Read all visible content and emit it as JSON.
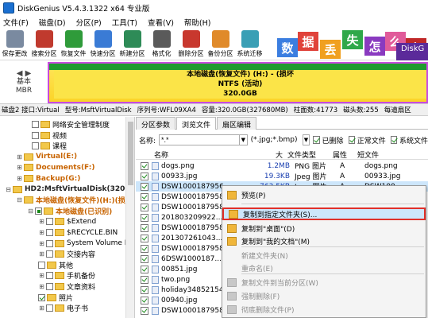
{
  "title": "DiskGenius V5.4.3.1322 x64 专业版",
  "menu": [
    "文件(F)",
    "磁盘(D)",
    "分区(P)",
    "工具(T)",
    "查看(V)",
    "帮助(H)"
  ],
  "toolbar": [
    {
      "label": "保存更改",
      "icon": "save-icon",
      "color": "#7a8aa0"
    },
    {
      "label": "搜索分区",
      "icon": "search-icon",
      "color": "#c03a2e"
    },
    {
      "label": "恢复文件",
      "icon": "recover-icon",
      "color": "#2f9b3a"
    },
    {
      "label": "快速分区",
      "icon": "quick-partition-icon",
      "color": "#3a7bd5"
    },
    {
      "label": "新建分区",
      "icon": "new-partition-icon",
      "color": "#2e8b57"
    },
    {
      "label": "格式化",
      "icon": "format-icon",
      "color": "#5a5a5a"
    },
    {
      "label": "删除分区",
      "icon": "delete-icon",
      "color": "#c8382e"
    },
    {
      "label": "备份分区",
      "icon": "backup-icon",
      "color": "#e08a2a"
    },
    {
      "label": "系统迁移",
      "icon": "migrate-icon",
      "color": "#3a9fb5"
    }
  ],
  "ad": {
    "chars": [
      "数",
      "据",
      "丢",
      "失",
      "怎",
      "么",
      "办"
    ],
    "brand": "DiskG"
  },
  "diskmap": {
    "nav_label": "基本\nMBR",
    "partition_name": "本地磁盘(恢复文件) (H:) - (损坏",
    "fs": "NTFS (活动)",
    "size": "320.0GB"
  },
  "status": [
    "磁盘2 接口:Virtual",
    "型号:MsftVirtualDisk",
    "序列号:WFL09XA4",
    "容量:320.0GB(327680MB)",
    "柱面数:41773",
    "磁头数:255",
    "每道扇区"
  ],
  "tree": [
    {
      "label": "网络安全管理制度",
      "indent": 40,
      "exp": "",
      "check": "",
      "style": ""
    },
    {
      "label": "视频",
      "indent": 40,
      "exp": "",
      "check": "",
      "style": ""
    },
    {
      "label": "课程",
      "indent": 40,
      "exp": "",
      "check": "",
      "style": ""
    },
    {
      "label": "Virtual(E:)",
      "indent": 20,
      "exp": "+",
      "check": "",
      "style": "orange"
    },
    {
      "label": "Documents(F:)",
      "indent": 20,
      "exp": "+",
      "check": "",
      "style": "orange"
    },
    {
      "label": "Backup(G:)",
      "indent": 20,
      "exp": "+",
      "check": "",
      "style": "orange"
    },
    {
      "label": "HD2:MsftVirtualDisk(320GB)",
      "indent": 6,
      "exp": "-",
      "check": "",
      "style": "dark-bold"
    },
    {
      "label": "本地磁盘(恢复文件)(H:)(损坏",
      "indent": 20,
      "exp": "-",
      "check": "",
      "style": "orange"
    },
    {
      "label": "本地磁盘(已识别)",
      "indent": 34,
      "exp": "-",
      "check": "part",
      "style": "orange"
    },
    {
      "label": "$Extend",
      "indent": 48,
      "exp": "+",
      "check": "",
      "style": ""
    },
    {
      "label": "$RECYCLE.BIN",
      "indent": 48,
      "exp": "+",
      "check": "",
      "style": ""
    },
    {
      "label": "System Volume In",
      "indent": 48,
      "exp": "+",
      "check": "",
      "style": ""
    },
    {
      "label": "交接内容",
      "indent": 48,
      "exp": "+",
      "check": "",
      "style": ""
    },
    {
      "label": "其他",
      "indent": 48,
      "exp": "",
      "check": "",
      "style": ""
    },
    {
      "label": "手机备份",
      "indent": 48,
      "exp": "+",
      "check": "",
      "style": ""
    },
    {
      "label": "文章资料",
      "indent": 48,
      "exp": "+",
      "check": "",
      "style": ""
    },
    {
      "label": "照片",
      "indent": 48,
      "exp": "",
      "check": "on",
      "style": ""
    },
    {
      "label": "电子书",
      "indent": 48,
      "exp": "+",
      "check": "",
      "style": ""
    }
  ],
  "tabs": [
    "分区参数",
    "浏览文件",
    "扇区编辑"
  ],
  "filter": {
    "name_value": "*.*",
    "ext_value": "(*.jpg;*.bmp)",
    "deleted": "已删除",
    "normal": "正常文件",
    "system": "系统文件"
  },
  "columns": {
    "name": "名称",
    "size": "大",
    "type": "文件类型",
    "attr": "属性",
    "short": "短文件"
  },
  "files": [
    {
      "name": "dogs.png",
      "size": "1.2MB",
      "type": "PNG 图片",
      "attr": "A",
      "short": "dogs.png"
    },
    {
      "name": "00933.jpg",
      "size": "19.3KB",
      "type": "Jpeg 图片",
      "attr": "A",
      "short": "00933.jpg"
    },
    {
      "name": "DSW1000187956...",
      "size": "763.5KB",
      "type": "Jpeg 图片",
      "attr": "A",
      "short": "DSW100~"
    },
    {
      "name": "DSW1000187958...",
      "size": "",
      "type": "",
      "attr": "",
      "short": ""
    },
    {
      "name": "DSW1000187958...",
      "size": "",
      "type": "",
      "attr": "",
      "short": ""
    },
    {
      "name": "201803209922...",
      "size": "",
      "type": "",
      "attr": "",
      "short": ""
    },
    {
      "name": "DSW1000187958...",
      "size": "",
      "type": "",
      "attr": "",
      "short": ""
    },
    {
      "name": "201307261043...",
      "size": "",
      "type": "",
      "attr": "",
      "short": ""
    },
    {
      "name": "DSW1000187958...",
      "size": "",
      "type": "",
      "attr": "",
      "short": ""
    },
    {
      "name": "6DSW1000187...",
      "size": "",
      "type": "",
      "attr": "",
      "short": ""
    },
    {
      "name": "00851.jpg",
      "size": "",
      "type": "",
      "attr": "",
      "short": ""
    },
    {
      "name": "two.png",
      "size": "",
      "type": "",
      "attr": "",
      "short": ""
    },
    {
      "name": "holiday34852154...",
      "size": "",
      "type": "",
      "attr": "",
      "short": ""
    },
    {
      "name": "00940.jpg",
      "size": "",
      "type": "",
      "attr": "",
      "short": ""
    },
    {
      "name": "DSW1000187958...",
      "size": "",
      "type": "",
      "attr": "",
      "short": ""
    }
  ],
  "context_menu": [
    {
      "label": "预览(P)",
      "state": "normal",
      "icon": "preview-icon"
    },
    {
      "label": "复制到指定文件夹(S)...",
      "state": "highlight",
      "icon": "copy-folder-icon"
    },
    {
      "label": "复制到\"桌面\"(D)",
      "state": "normal",
      "icon": "copy-desktop-icon"
    },
    {
      "label": "复制到\"我的文档\"(M)",
      "state": "normal",
      "icon": "copy-documents-icon"
    },
    {
      "label": "新建文件夹(N)",
      "state": "disabled",
      "icon": ""
    },
    {
      "label": "重命名(E)",
      "state": "disabled",
      "icon": ""
    },
    {
      "label": "复制文件到当前分区(W)",
      "state": "disabled",
      "icon": "copy-partition-icon"
    },
    {
      "label": "强制删除(F)",
      "state": "disabled",
      "icon": "force-delete-icon"
    },
    {
      "label": "彻底删除文件(P)",
      "state": "disabled",
      "icon": "wipe-icon"
    }
  ]
}
